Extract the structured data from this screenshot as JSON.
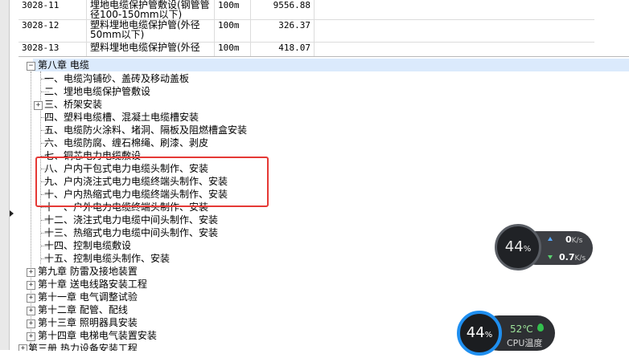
{
  "grid": {
    "rows": [
      {
        "code": "3028-11",
        "name": "埋地电缆保护管敷设(钢管管径100-150mm以下)",
        "unit": "100m",
        "price": "9556.88"
      },
      {
        "code": "3028-12",
        "name": "塑料埋地电缆保护管(外径50mm以下)",
        "unit": "100m",
        "price": "326.37"
      },
      {
        "code": "3028-13",
        "name": "塑料埋地电缆保护管(外径",
        "unit": "100m",
        "price": "418.07"
      }
    ]
  },
  "tree": {
    "chapter8": {
      "label": "第八章 电缆"
    },
    "chapter8_items": [
      "一、电缆沟铺砂、盖砖及移动盖板",
      "二、埋地电缆保护管敷设",
      "三、桥架安装",
      "四、塑料电缆槽、混凝土电缆槽安装",
      "五、电缆防火涂料、堵洞、隔板及阻燃槽盒安装",
      "六、电缆防腐、缠石棉绳、刷漆、剥皮",
      "七、铜芯电力电缆敷设",
      "八、户内干包式电力电缆头制作、安装",
      "九、户内浇注式电力电缆终端头制作、安装",
      "十、户内热缩式电力电缆终端头制作、安装",
      "十一、户外电力电缆终端头制作、安装",
      "十二、浇注式电力电缆中间头制作、安装",
      "十三、热缩式电力电缆中间头制作、安装",
      "十四、控制电缆敷设",
      "十五、控制电缆头制作、安装"
    ],
    "chapters": [
      "第九章 防雷及接地装置",
      "第十章 送电线路安装工程",
      "第十一章 电气调整试验",
      "第十二章 配管、配线",
      "第十三章 照明器具安装",
      "第十四章 电梯电气装置安装"
    ],
    "book3": "第三册 热力设备安装工程"
  },
  "net_widget": {
    "percent": "44",
    "percent_unit": "%",
    "up_value": "0",
    "up_unit": "K/s",
    "down_value": "0.7",
    "down_unit": "K/s"
  },
  "cpu_widget": {
    "percent": "44",
    "percent_unit": "%",
    "temp": "52℃",
    "label": "CPU温度"
  }
}
